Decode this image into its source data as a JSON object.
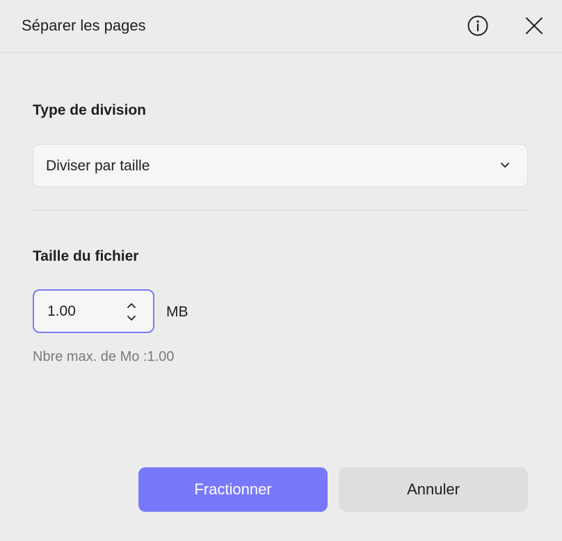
{
  "dialog": {
    "title": "Séparer les pages"
  },
  "icons": {
    "info": "info-circle-icon",
    "close": "close-icon",
    "select_chevron": "chevron-down-icon",
    "spin_up": "chevron-up-icon",
    "spin_down": "chevron-down-icon"
  },
  "split_type": {
    "label": "Type de division",
    "selected": "Diviser par taille"
  },
  "file_size": {
    "label": "Taille du fichier",
    "value": "1.00",
    "unit": "MB",
    "hint": "Nbre max. de Mo :1.00"
  },
  "actions": {
    "primary_label": "Fractionner",
    "secondary_label": "Annuler"
  },
  "colors": {
    "accent": "#7878fb",
    "focus_border": "#7b7bf2",
    "background": "#ececec",
    "secondary_button": "#dedede"
  }
}
